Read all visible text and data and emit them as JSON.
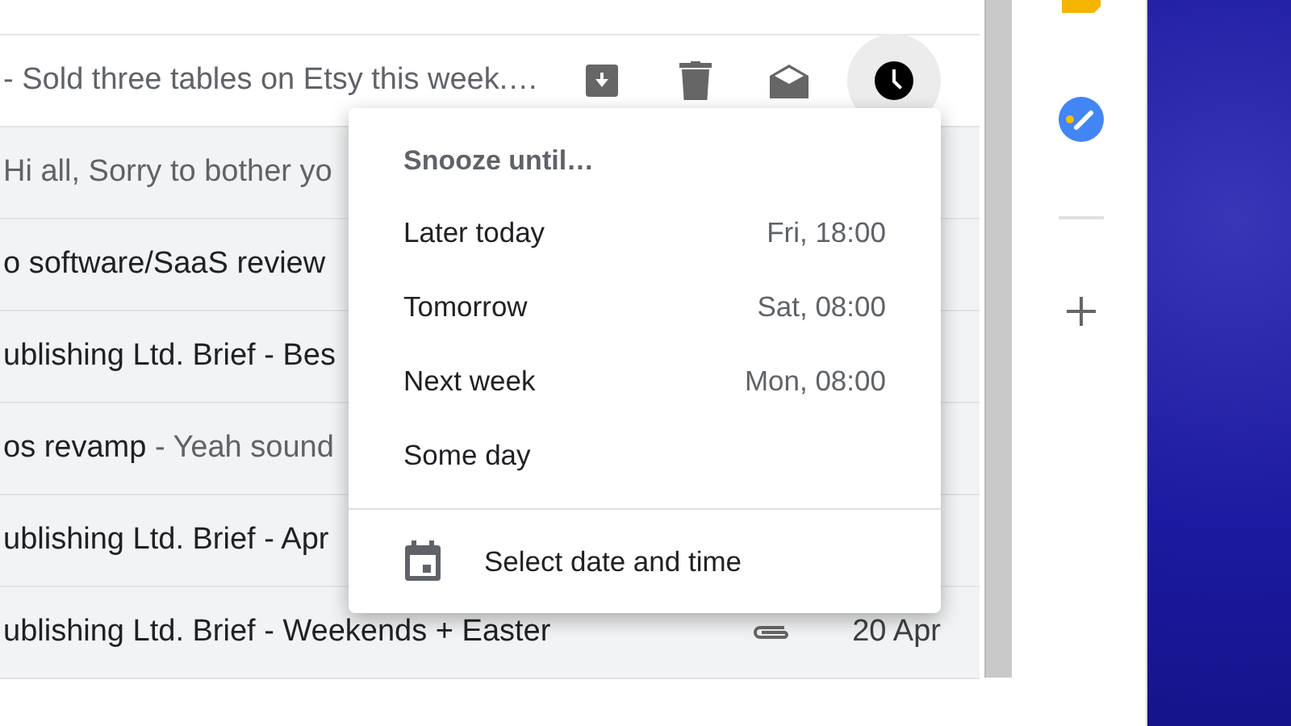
{
  "mail_rows": [
    {
      "subject": "",
      "snippet": "- Sold three tables on Etsy this week.…",
      "hovered": true,
      "actions": [
        {
          "kind": "archive"
        },
        {
          "kind": "delete"
        },
        {
          "kind": "mark-read"
        },
        {
          "kind": "snooze"
        }
      ]
    },
    {
      "subject": "",
      "snippet": "Hi all, Sorry to bother yo",
      "hovered": false
    },
    {
      "subject": "o software/SaaS review",
      "snippet": "",
      "hovered": false
    },
    {
      "subject": "ublishing Ltd. Brief - Bes",
      "snippet": "",
      "hovered": false
    },
    {
      "subject": "os revamp",
      "snippet": " - Yeah sound",
      "hovered": false
    },
    {
      "subject": "ublishing Ltd. Brief - Apr",
      "snippet": "",
      "hovered": false
    },
    {
      "subject": "ublishing Ltd. Brief - Weekends + Easter",
      "snippet": "",
      "hovered": false,
      "attachment": true,
      "date": "20 Apr"
    }
  ],
  "snooze_menu": {
    "title": "Snooze until…",
    "options": [
      {
        "label": "Later today",
        "time": "Fri, 18:00"
      },
      {
        "label": "Tomorrow",
        "time": "Sat, 08:00"
      },
      {
        "label": "Next week",
        "time": "Mon, 08:00"
      },
      {
        "label": "Some day"
      }
    ],
    "custom": "Select date and time"
  }
}
